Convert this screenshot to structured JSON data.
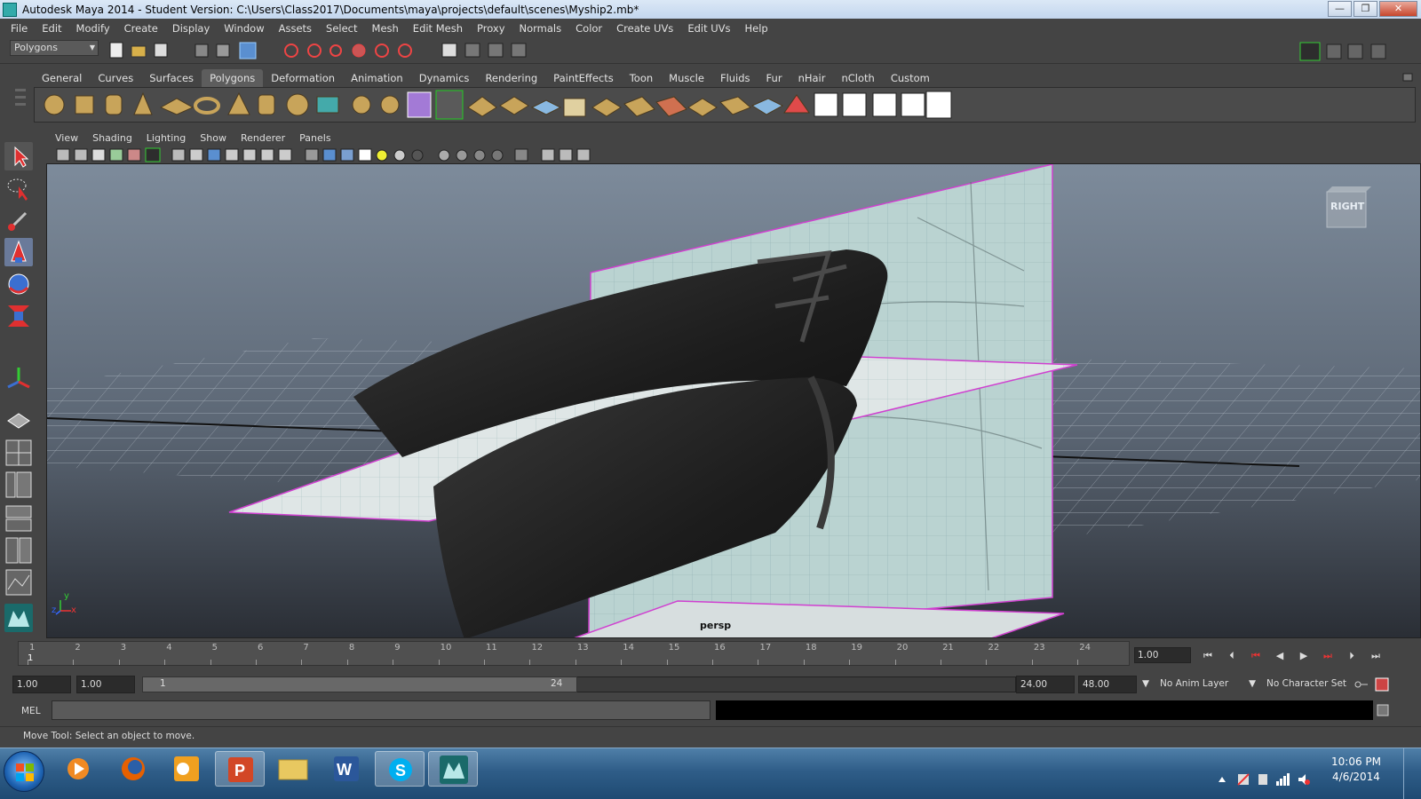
{
  "window": {
    "title": "Autodesk Maya 2014 - Student Version: C:\\Users\\Class2017\\Documents\\maya\\projects\\default\\scenes\\Myship2.mb*",
    "buttons": {
      "minimize": "—",
      "maximize": "❐",
      "close": "✕"
    }
  },
  "menubar": [
    "File",
    "Edit",
    "Modify",
    "Create",
    "Display",
    "Window",
    "Assets",
    "Select",
    "Mesh",
    "Edit Mesh",
    "Proxy",
    "Normals",
    "Color",
    "Create UVs",
    "Edit UVs",
    "Help"
  ],
  "statusline": {
    "mode": "Polygons"
  },
  "shelf": {
    "tabs": [
      "General",
      "Curves",
      "Surfaces",
      "Polygons",
      "Deformation",
      "Animation",
      "Dynamics",
      "Rendering",
      "PaintEffects",
      "Toon",
      "Muscle",
      "Fluids",
      "Fur",
      "nHair",
      "nCloth",
      "Custom"
    ],
    "active_tab": "Polygons"
  },
  "panel": {
    "menus": [
      "View",
      "Shading",
      "Lighting",
      "Show",
      "Renderer",
      "Panels"
    ],
    "camera_label": "persp",
    "viewcube_label": "RIGHT",
    "axis_y": "y",
    "axis_z": "z",
    "axis_x": "x"
  },
  "timeline": {
    "ticks": [
      "1",
      "2",
      "3",
      "4",
      "5",
      "6",
      "7",
      "8",
      "9",
      "10",
      "11",
      "12",
      "13",
      "14",
      "15",
      "16",
      "17",
      "18",
      "19",
      "20",
      "21",
      "22",
      "23",
      "24"
    ],
    "current_frame": "1",
    "current_time": "1.00"
  },
  "range": {
    "start_time": "1.00",
    "playback_start": "1.00",
    "range_start_label": "1",
    "range_end_label": "24",
    "playback_end": "24.00",
    "end_time": "48.00",
    "anim_layer": "No Anim Layer",
    "character_set": "No Character Set"
  },
  "command": {
    "label": "MEL"
  },
  "helpline": {
    "text": "Move Tool: Select an object to move."
  },
  "taskbar": {
    "time": "10:06 PM",
    "date": "4/6/2014"
  },
  "colors": {
    "accent_magenta": "#d040d0",
    "hull": "#1e1e1e",
    "blueprint": "#b8d4d4"
  }
}
